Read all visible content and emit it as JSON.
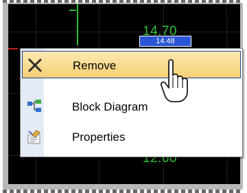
{
  "chart": {
    "value_top": "14.70",
    "value_box": "14.48",
    "value_bottom": "12.60",
    "trace_color": "#2ec234",
    "background": "#000000"
  },
  "context_menu": {
    "items": [
      {
        "label": "Remove",
        "icon": "close-x-icon",
        "highlighted": true
      },
      {
        "label": "Block Diagram",
        "icon": "block-diagram-icon",
        "highlighted": false
      },
      {
        "label": "Properties",
        "icon": "properties-icon",
        "highlighted": false
      }
    ]
  },
  "colors": {
    "highlight_top": "#fde9b3",
    "highlight_bottom": "#f8cf75",
    "highlight_border": "#1a3d94",
    "gutter": "#e4ebf7"
  }
}
